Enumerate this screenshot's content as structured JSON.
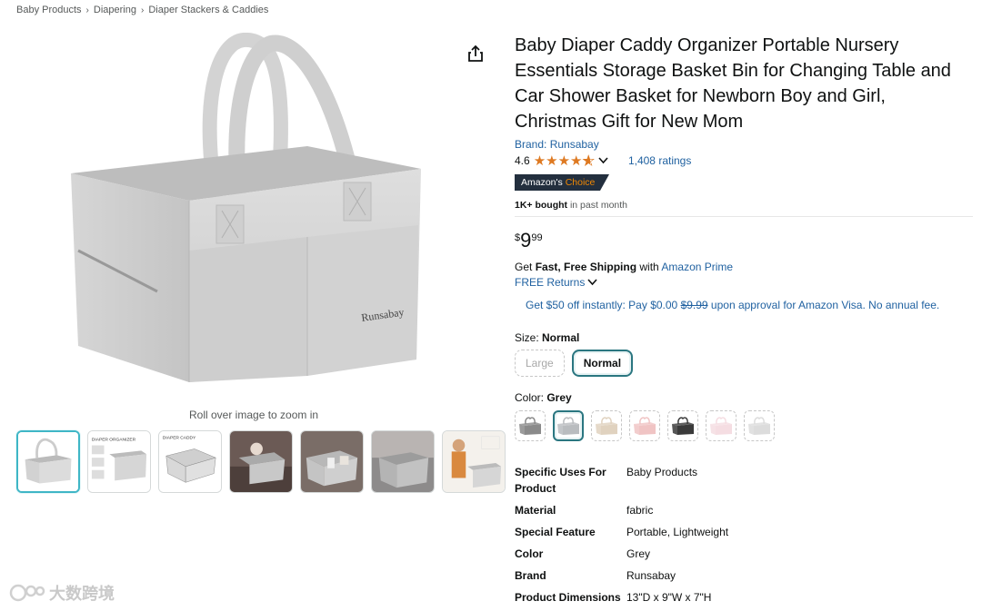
{
  "breadcrumb": [
    "Baby Products",
    "Diapering",
    "Diaper Stackers & Caddies"
  ],
  "main_image": {
    "alt": "Grey felt diaper caddy",
    "icon": "diaper-caddy-photo"
  },
  "zoom_hint": "Roll over image to zoom in",
  "thumbnails": [
    "thumb-1",
    "thumb-2",
    "thumb-3",
    "thumb-4",
    "thumb-5",
    "thumb-6",
    "thumb-7"
  ],
  "thumbnail_captions": [
    "DIAPER ORGANIZER",
    "DIAPER CADDY"
  ],
  "product": {
    "title": "Baby Diaper Caddy Organizer Portable Nursery Essentials Storage Basket Bin for Changing Table and Car Shower Basket for Newborn Boy and Girl, Christmas Gift for New Mom",
    "brand": "Brand: Runsabay",
    "rating": "4.6",
    "rating_value": 4.6,
    "ratings_count": "1,408 ratings",
    "badge_prefix": "Amazon's",
    "badge_suffix": "Choice",
    "bought_bold": "1K+ bought",
    "bought_rest": " in past month",
    "price_symbol": "$",
    "price_whole": "9",
    "price_fraction": "99",
    "shipping_prefix": "Get ",
    "shipping_bold": "Fast, Free Shipping",
    "shipping_mid": " with ",
    "shipping_link": "Amazon Prime",
    "returns": "FREE Returns",
    "promo_a": "Get $50 off instantly: Pay $0.00 ",
    "promo_strike": "$9.99",
    "promo_b": " upon approval for Amazon Visa. No annual fee."
  },
  "size": {
    "label": "Size: ",
    "selected": "Normal",
    "options": [
      "Large",
      "Normal"
    ]
  },
  "color": {
    "label": "Color: ",
    "selected": "Grey",
    "swatches": [
      "#8a8a8a",
      "#b9bcbf",
      "#e0d2bf",
      "#f0c4c4",
      "#3a3a3a",
      "#f5dde2",
      "#dcdcdc"
    ]
  },
  "specs": [
    {
      "key": "Specific Uses For Product",
      "value": "Baby Products"
    },
    {
      "key": "Material",
      "value": "fabric"
    },
    {
      "key": "Special Feature",
      "value": "Portable, Lightweight"
    },
    {
      "key": "Color",
      "value": "Grey"
    },
    {
      "key": "Brand",
      "value": "Runsabay"
    },
    {
      "key": "Product Dimensions",
      "value": "13\"D x 9\"W x 7\"H"
    }
  ],
  "image_brand_text": "Runsabay",
  "watermark": "大数跨境"
}
